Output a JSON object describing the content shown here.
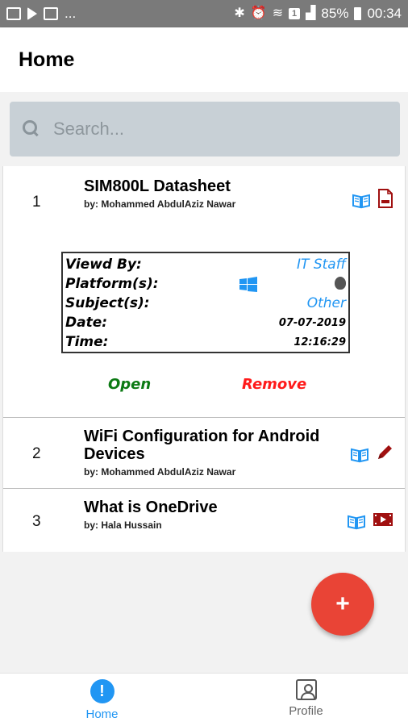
{
  "status_bar": {
    "icons_left": [
      "image-icon",
      "play-icon",
      "bag-icon"
    ],
    "ellipsis": "...",
    "icons_right": [
      "bluetooth-icon",
      "alarm-icon",
      "wifi-icon",
      "sim-icon",
      "signal-icon"
    ],
    "sim_number": "1",
    "battery": "85%",
    "time": "00:34"
  },
  "app_bar": {
    "title": "Home"
  },
  "search": {
    "placeholder": "Search..."
  },
  "items": [
    {
      "number": "1",
      "title": "SIM800L Datasheet",
      "author": "by: Mohammed AbdulAziz Nawar",
      "type_icons": [
        "book-icon",
        "pdf-icon"
      ],
      "details": {
        "viewed_label": "Viewd By:",
        "viewed_value": "IT Staff",
        "platform_label": "Platform(s):",
        "platform_icons": [
          "windows-icon",
          "apple-icon"
        ],
        "subject_label": "Subject(s):",
        "subject_value": "Other",
        "date_label": "Date:",
        "date_value": "07-07-2019",
        "time_label": "Time:",
        "time_value": "12:16:29"
      },
      "open_label": "Open",
      "remove_label": "Remove"
    },
    {
      "number": "2",
      "title": "WiFi Configuration for Android Devices",
      "author": "by: Mohammed AbdulAziz Nawar",
      "type_icons": [
        "book-icon",
        "pencil-icon"
      ]
    },
    {
      "number": "3",
      "title": "What is OneDrive",
      "author": "by: Hala Hussain",
      "type_icons": [
        "book-icon",
        "video-icon"
      ]
    }
  ],
  "fab": {
    "label": "+"
  },
  "bottom_nav": {
    "home_label": "Home",
    "profile_label": "Profile"
  },
  "colors": {
    "accent": "#2196f3",
    "fab": "#e94436",
    "open": "#0c7a14",
    "remove": "#ff1a1a",
    "doc_icon": "#a01010"
  }
}
